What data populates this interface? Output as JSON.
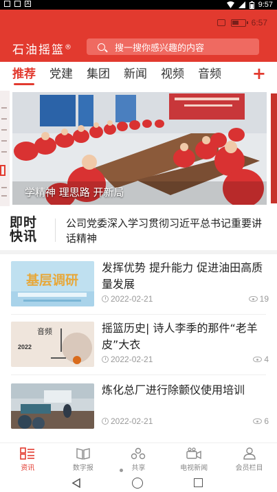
{
  "system": {
    "time": "9:57",
    "notif_a": "A"
  },
  "header": {
    "battery_time": "6:57",
    "app_title": "石油摇篮",
    "registered": "®",
    "search_placeholder": "搜一搜你感兴趣的内容"
  },
  "tabs": [
    {
      "label": "推荐",
      "active": true
    },
    {
      "label": "党建"
    },
    {
      "label": "集团"
    },
    {
      "label": "新闻"
    },
    {
      "label": "视频"
    },
    {
      "label": "音频"
    }
  ],
  "tab_add": "+",
  "banner": {
    "caption": "学精神 理思路 开新局"
  },
  "flash": {
    "logo_line1": "即时",
    "logo_line2": "快讯",
    "text": "公司党委深入学习贯彻习近平总书记重要讲话精神"
  },
  "news": [
    {
      "title": "发挥优势 提升能力 促进油田高质量发展",
      "date": "2022-02-21",
      "views": "19",
      "thumb_text": "基层调研"
    },
    {
      "title": "摇篮历史| 诗人李季的那件“老羊皮”大衣",
      "date": "2022-02-21",
      "views": "4",
      "thumb_text": "音频",
      "thumb_year": "2022"
    },
    {
      "title": "炼化总厂进行除颤仪使用培训",
      "date": "2022-02-21",
      "views": "6"
    }
  ],
  "bottom_nav": [
    {
      "label": "资讯",
      "icon": "news-icon",
      "active": true
    },
    {
      "label": "数字报",
      "icon": "newspaper-icon"
    },
    {
      "label": "共享",
      "icon": "share-icon"
    },
    {
      "label": "电视新闻",
      "icon": "tv-camera-icon"
    },
    {
      "label": "会员栏目",
      "icon": "user-icon"
    }
  ],
  "colors": {
    "brand_red": "#e23a2f",
    "search_bg": "#ef6a61"
  }
}
